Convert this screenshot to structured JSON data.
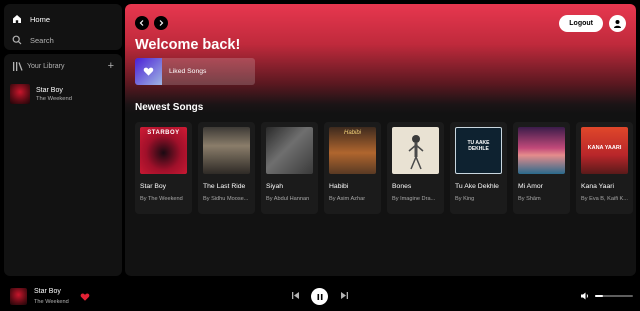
{
  "sidebar": {
    "nav": [
      {
        "label": "Home",
        "icon": "home-icon"
      },
      {
        "label": "Search",
        "icon": "search-icon"
      }
    ],
    "library": {
      "title": "Your Library",
      "items": [
        {
          "title": "Star Boy",
          "artist": "The Weekend"
        }
      ]
    }
  },
  "header": {
    "logout_label": "Logout",
    "welcome": "Welcome back!",
    "liked_songs": "Liked Songs"
  },
  "section": {
    "title": "Newest Songs"
  },
  "songs": [
    {
      "title": "Star Boy",
      "artist": "By The Weekend",
      "cover_text": "STARBOY"
    },
    {
      "title": "The Last Ride",
      "artist": "By Sidhu Moose...",
      "cover_text": ""
    },
    {
      "title": "Siyah",
      "artist": "By Abdul Hannan",
      "cover_text": ""
    },
    {
      "title": "Habibi",
      "artist": "By Asim Azhar",
      "cover_text": "Habibi"
    },
    {
      "title": "Bones",
      "artist": "By Imagine Dra...",
      "cover_text": ""
    },
    {
      "title": "Tu Ake Dekhle",
      "artist": "By King",
      "cover_text": "TU AAKE DEKHLE"
    },
    {
      "title": "Mi Amor",
      "artist": "By Shām",
      "cover_text": ""
    },
    {
      "title": "Kana Yaari",
      "artist": "By Eva B, Kaifi K...",
      "cover_text": "KANA YAARI"
    }
  ],
  "player": {
    "title": "Star Boy",
    "artist": "The Weekend",
    "volume": 0.2
  },
  "colors": {
    "accent_red": "#e7374f",
    "heart_red": "#e22134",
    "background": "#121212"
  }
}
